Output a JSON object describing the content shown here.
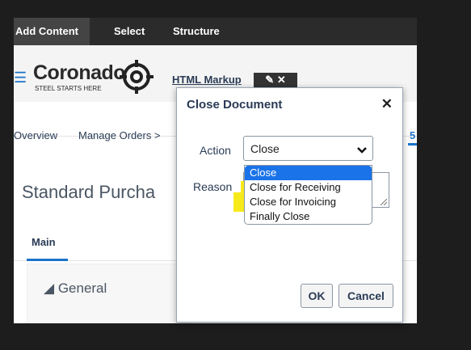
{
  "topbar": {
    "tabs": [
      {
        "label": "Add Content"
      },
      {
        "label": "Select"
      },
      {
        "label": "Structure"
      }
    ]
  },
  "logo": {
    "wordmark": "Coronado",
    "tagline": "STEEL STARTS HERE"
  },
  "markup": {
    "label": "HTML Markup"
  },
  "breadcrumb": {
    "items": [
      "Overview",
      "Manage Orders >"
    ],
    "right_fragment": "5"
  },
  "page": {
    "title": "Standard Purcha",
    "subtab": "Main",
    "section": "General"
  },
  "dialog": {
    "title": "Close Document",
    "action_label": "Action",
    "reason_label": "Reason",
    "action_value": "Close",
    "options": [
      "Close",
      "Close for Receiving",
      "Close for Invoicing",
      "Finally Close"
    ],
    "ok_label": "OK",
    "cancel_label": "Cancel"
  },
  "colors": {
    "accent": "#1a73c9",
    "selected": "#1a73e8",
    "highlight": "#f7ea1c"
  }
}
